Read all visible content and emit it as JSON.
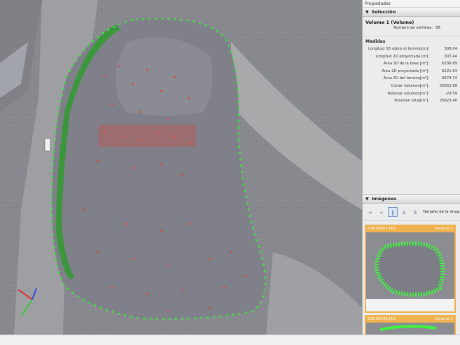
{
  "viewport": {
    "background_color": "#8a8b90",
    "boundary_color": "#3ee23e",
    "points_color": "#e0443c"
  },
  "properties": {
    "title": "Propiedades",
    "selection_header": "Selección",
    "object_name": "Volume 1 (Volume)",
    "vertex_label": "Número de vértices:",
    "vertex_count": "95",
    "measures_header": "Medidas",
    "measures": [
      {
        "label": "Longitud 3D sobre el terreno[m]:",
        "value": "308.04"
      },
      {
        "label": "Longitud 2D proyectada [m]:",
        "value": "307.44"
      },
      {
        "label": "Área 3D de la base [m²]:",
        "value": "6236.69"
      },
      {
        "label": "Área 2D proyectada [m²]:",
        "value": "6221.53"
      },
      {
        "label": "Área 3D del terreno[m²]:",
        "value": "9674.74"
      },
      {
        "label": "Cortar volumen[m³]:",
        "value": "25652.99"
      },
      {
        "label": "Rellenar volumen[m³]:",
        "value": "-29.59"
      },
      {
        "label": "Volumen total[m³]:",
        "value": "25623.40"
      }
    ]
  },
  "images": {
    "header": "Imágenes",
    "size_label": "Tamaño de la imag",
    "thumbnails": [
      {
        "filename": "DSC09051.JPG",
        "tag": "Volume 1"
      },
      {
        "filename": "DSC09035.JPG",
        "tag": "Volume 1"
      }
    ],
    "accent_color": "#efb24f"
  }
}
